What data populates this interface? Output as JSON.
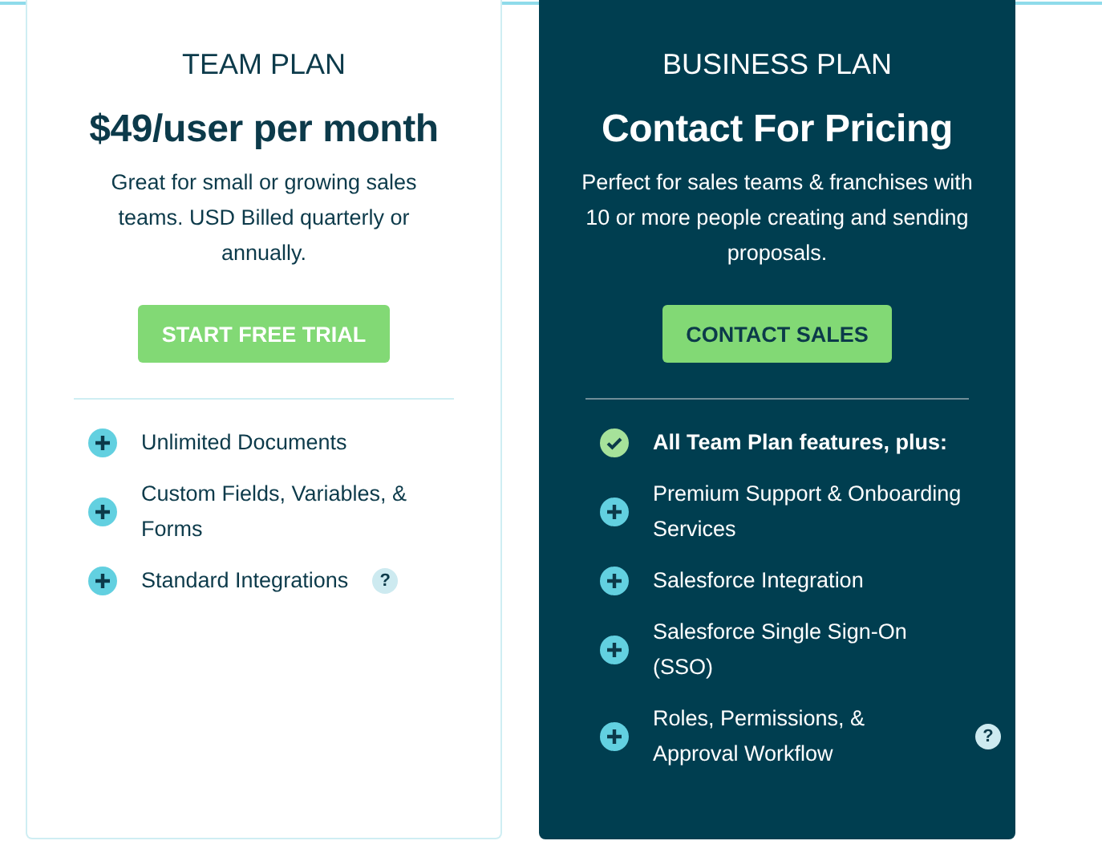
{
  "plans": [
    {
      "kind": "light",
      "name": "TEAM PLAN",
      "price": "$49/user per month",
      "description": "Great for small or growing sales teams. USD Billed quarterly or annually.",
      "button": "START FREE TRIAL",
      "features": [
        {
          "kind": "plus",
          "text": "Unlimited Documents"
        },
        {
          "kind": "plus",
          "text": "Custom Fields, Variables, & Forms"
        },
        {
          "kind": "plus",
          "text": "Standard Integrations",
          "help": "?"
        }
      ]
    },
    {
      "kind": "dark",
      "name": "BUSINESS PLAN",
      "price": "Contact For Pricing",
      "description": "Perfect for sales teams & franchises with 10 or more people creating and sending proposals.",
      "button": "CONTACT SALES",
      "features": [
        {
          "kind": "check",
          "text": "All Team Plan features, plus:"
        },
        {
          "kind": "plus",
          "text": "Premium Support & Onboarding Services"
        },
        {
          "kind": "plus",
          "text": "Salesforce Integration"
        },
        {
          "kind": "plus",
          "text": "Salesforce Single Sign-On (SSO)"
        },
        {
          "kind": "plus",
          "text": "Roles, Permissions, & Approval Workflow",
          "help": "?"
        }
      ]
    }
  ]
}
